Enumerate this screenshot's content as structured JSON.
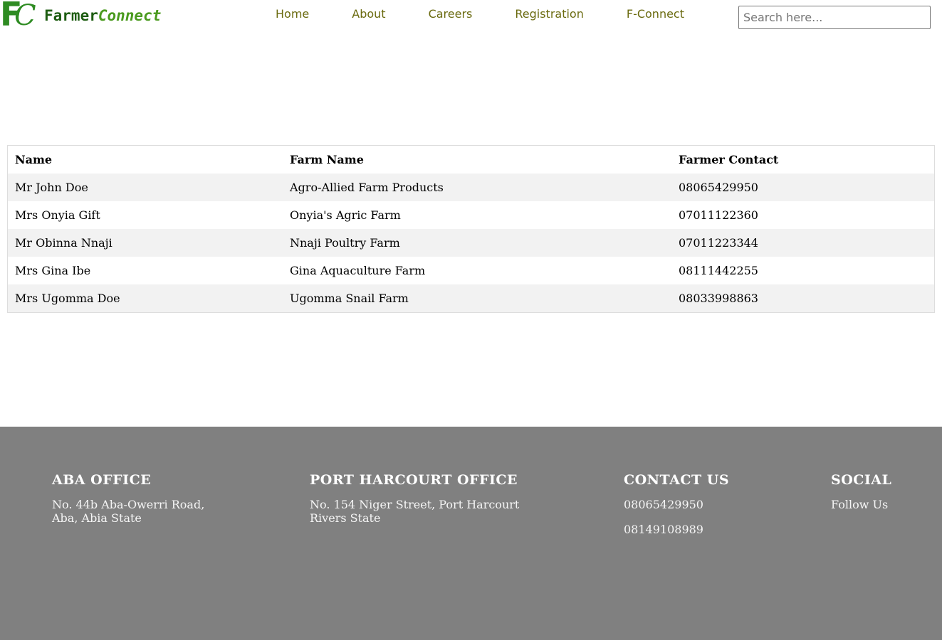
{
  "brand": {
    "mark_f": "F",
    "mark_c": "C",
    "name_part1": "Farmer",
    "name_part2": "Connect",
    "brand_color": "#2e8b22"
  },
  "nav": {
    "items": [
      {
        "label": "Home"
      },
      {
        "label": "About"
      },
      {
        "label": "Careers"
      },
      {
        "label": "Registration"
      },
      {
        "label": "F-Connect"
      }
    ],
    "color": "#6b6b10"
  },
  "search": {
    "placeholder": "Search here...",
    "value": ""
  },
  "table": {
    "headers": [
      "Name",
      "Farm Name",
      "Farmer Contact"
    ],
    "rows": [
      [
        "Mr John Doe",
        "Agro-Allied Farm Products",
        "08065429950"
      ],
      [
        "Mrs Onyia Gift",
        "Onyia's Agric Farm",
        "07011122360"
      ],
      [
        "Mr Obinna Nnaji",
        "Nnaji Poultry Farm",
        "07011223344"
      ],
      [
        "Mrs Gina Ibe",
        "Gina Aquaculture Farm",
        "08111442255"
      ],
      [
        "Mrs Ugomma Doe",
        "Ugomma Snail Farm",
        "08033998863"
      ]
    ],
    "stripe_color": "#f2f2f2"
  },
  "footer": {
    "background": "#808080",
    "aba": {
      "title": "ABA OFFICE",
      "line1": "No. 44b Aba-Owerri Road,",
      "line2": "Aba, Abia State"
    },
    "ph": {
      "title": "PORT HARCOURT OFFICE",
      "line1": "No. 154 Niger Street, Port Harcourt",
      "line2": "Rivers State"
    },
    "contact": {
      "title": "CONTACT US",
      "phone1": "08065429950",
      "phone2": "08149108989"
    },
    "social": {
      "title": "SOCIAL",
      "follow": "Follow Us"
    }
  }
}
